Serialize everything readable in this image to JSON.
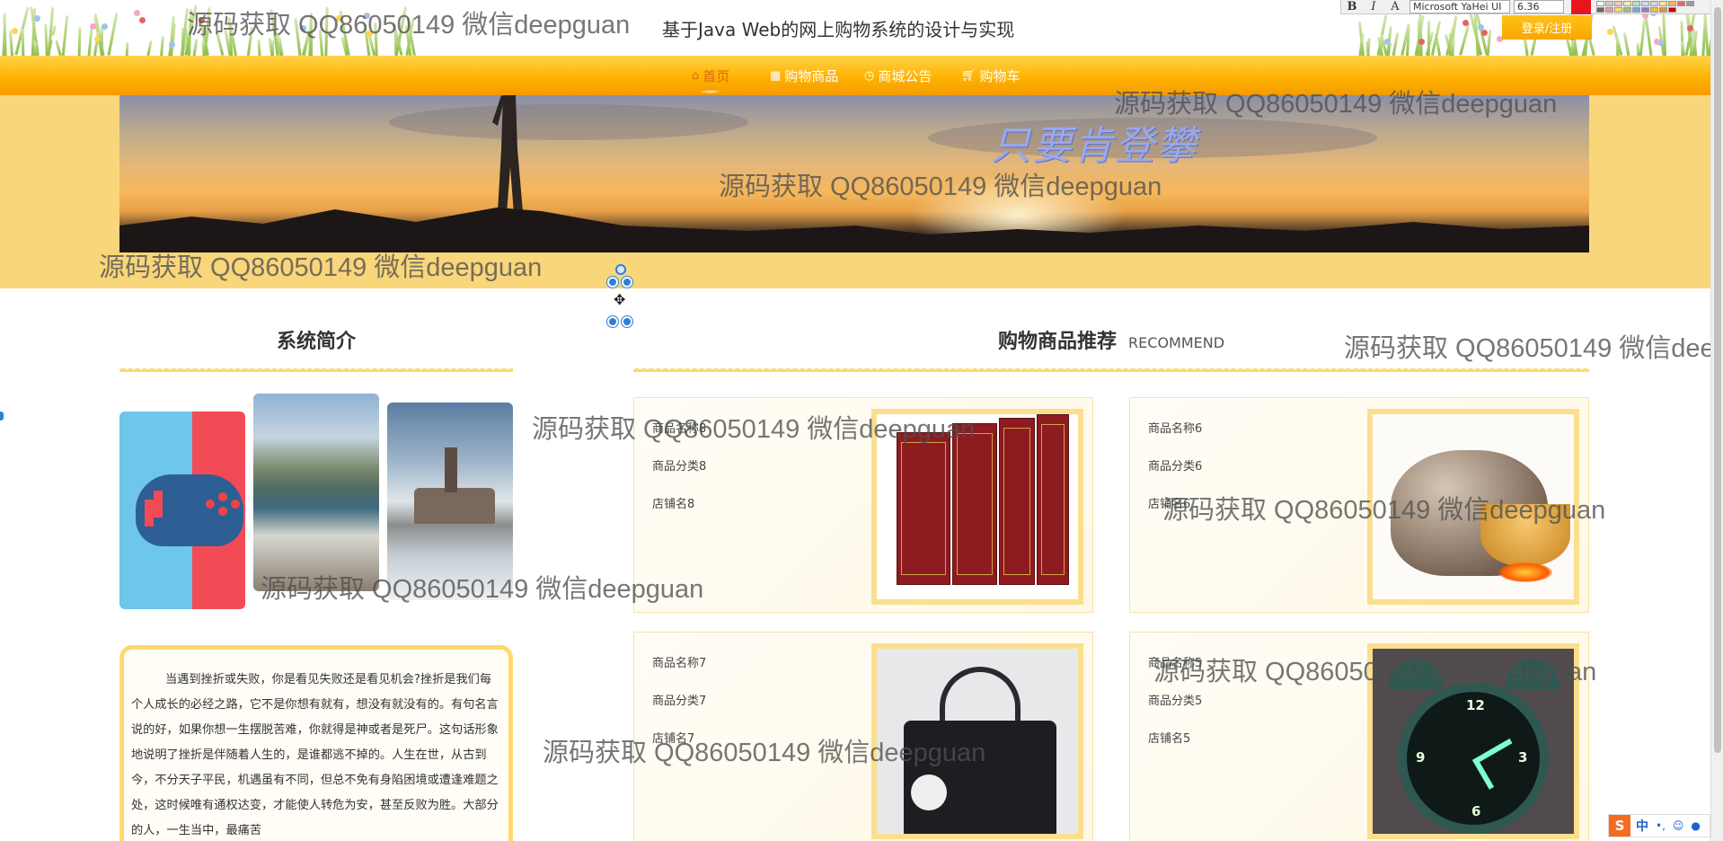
{
  "header": {
    "site_title": "基于Java Web的网上购物系统的设计与实现",
    "login_label": "登录/注册"
  },
  "editor_toolbar": {
    "bold": "B",
    "italic": "I",
    "font_effect": "A",
    "font_name": "Microsoft YaHei UI",
    "font_size": "6.36",
    "text_color": "#e8161c"
  },
  "nav": {
    "items": [
      {
        "label": "首页",
        "icon": "home-icon",
        "active": true
      },
      {
        "label": "购物商品",
        "icon": "grid-icon",
        "active": false
      },
      {
        "label": "商城公告",
        "icon": "clock-icon",
        "active": false
      },
      {
        "label": "购物车",
        "icon": "cart-icon",
        "active": false
      }
    ]
  },
  "banner": {
    "slogan": "只要肯登攀"
  },
  "intro": {
    "title": "系统简介",
    "images": [
      "game-controller-image",
      "beach-image",
      "castle-fog-image"
    ],
    "text": "当遇到挫折或失败，你是看见失败还是看见机会?挫折是我们每个人成长的必经之路，它不是你想有就有，想没有就没有的。有句名言说的好，如果你想一生摆脱苦难，你就得是神或者是死尸。这句话形象地说明了挫折是伴随着人生的，是谁都逃不掉的。人生在世，从古到今，不分天子平民，机遇虽有不同，但总不免有身陷困境或遭逢难题之处，这时候唯有通权达变，才能使人转危为安，甚至反败为胜。大部分的人，一生当中，最痛苦"
  },
  "recommend": {
    "title": "购物商品推荐",
    "subtitle": "RECOMMEND",
    "products": [
      {
        "name": "商品名称8",
        "category": "商品分类8",
        "shop": "店铺名8",
        "image": "book-set-image"
      },
      {
        "name": "商品名称6",
        "category": "商品分类6",
        "shop": "店铺名6",
        "image": "rice-cooker-image"
      },
      {
        "name": "商品名称7",
        "category": "商品分类7",
        "shop": "店铺名7",
        "image": "handbag-image"
      },
      {
        "name": "商品名称5",
        "category": "商品分类5",
        "shop": "店铺名5",
        "image": "alarm-clock-image"
      }
    ]
  },
  "watermark": "源码获取 QQ86050149 微信deepguan",
  "ime": {
    "logo": "S",
    "lang": "中"
  },
  "colors": {
    "nav_gradient_top": "#ffd24a",
    "nav_gradient_bottom": "#f49b00",
    "accent_yellow": "#fdd970",
    "nav_active_text": "#e2660f",
    "banner_area_bg": "#f9d67a"
  }
}
